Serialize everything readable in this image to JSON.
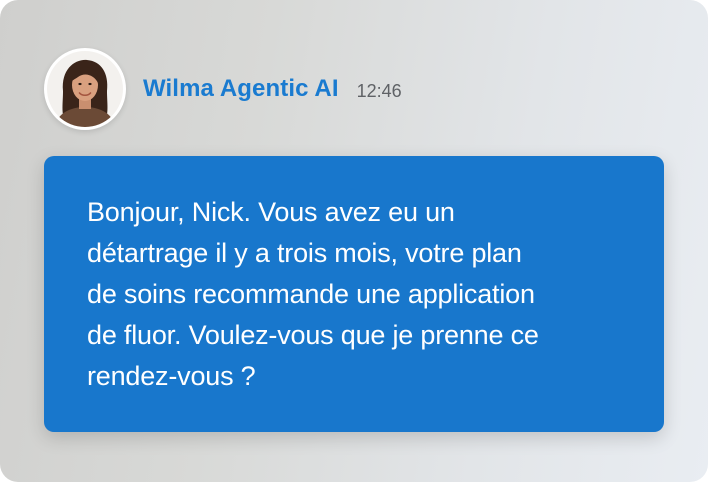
{
  "agent": {
    "name": "Wilma Agentic AI",
    "time": "12:46",
    "avatar_icon": "woman-portrait-avatar"
  },
  "message": {
    "lines": [
      "Bonjour, Nick. Vous avez eu un",
      "détartrage il y a trois mois, votre plan",
      "de soins recommande une application",
      "de fluor. Voulez-vous que je prenne ce",
      "rendez-vous ?"
    ]
  },
  "colors": {
    "accent": "#1a7bd0",
    "bubble": "#1877cc",
    "bubble_text": "#ffffff",
    "timestamp": "#5f6266"
  }
}
